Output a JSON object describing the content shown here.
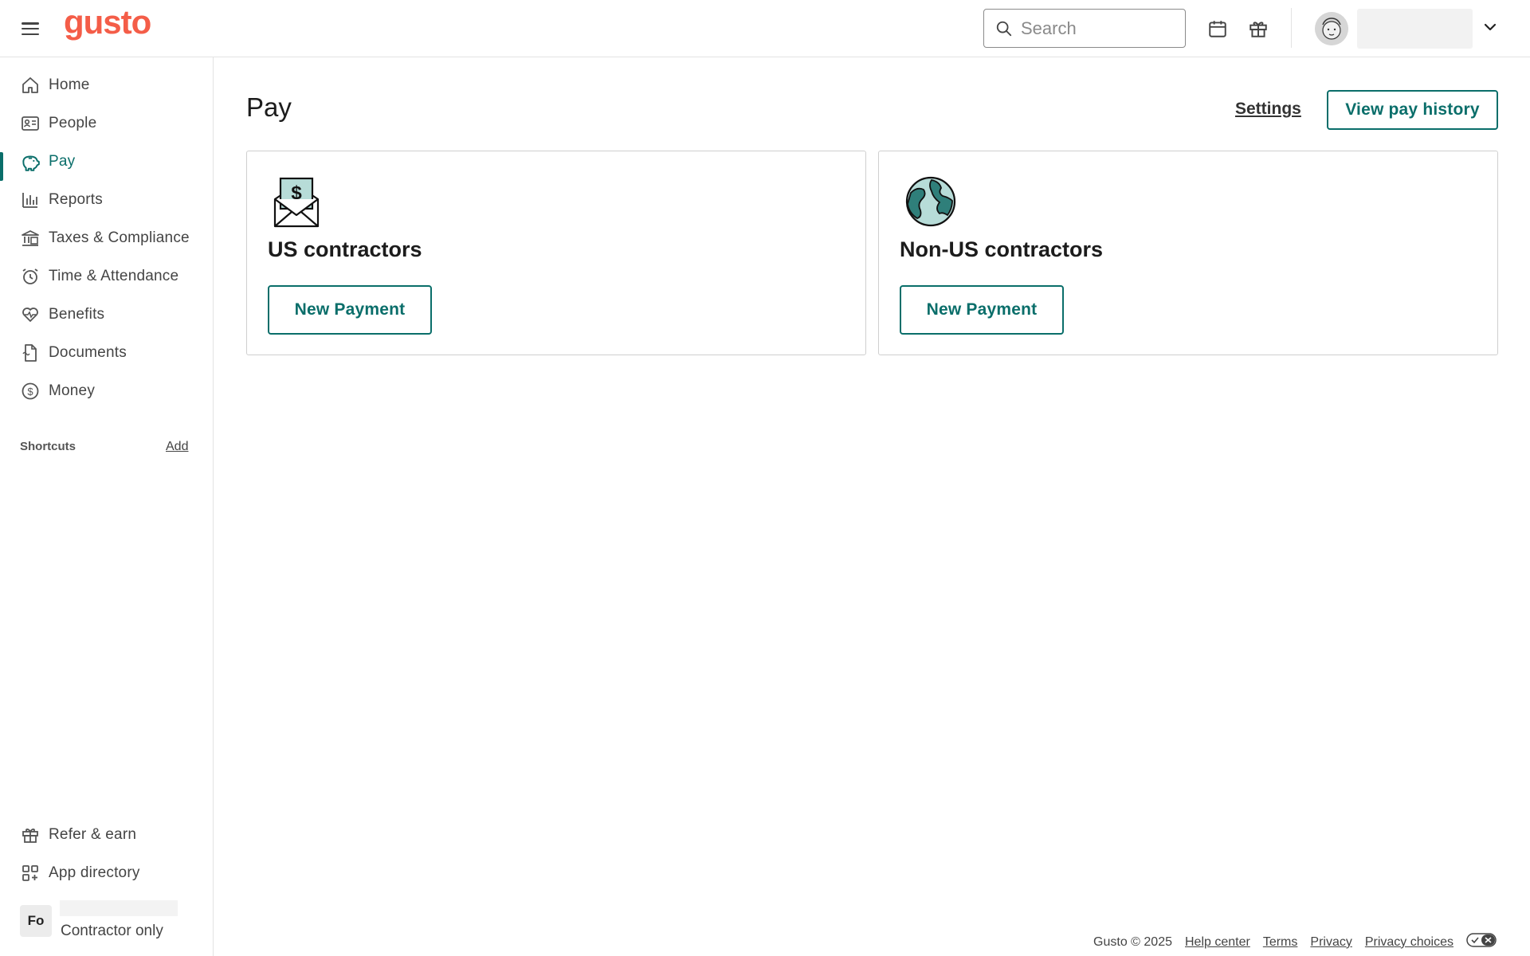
{
  "app": {
    "logo": "gusto"
  },
  "topbar": {
    "search_placeholder": "Search",
    "icons": [
      "calendar-icon",
      "gift-icon",
      "chevron-down-icon"
    ]
  },
  "sidebar": {
    "items": [
      {
        "label": "Home",
        "icon": "home-icon"
      },
      {
        "label": "People",
        "icon": "people-icon"
      },
      {
        "label": "Pay",
        "icon": "piggy-bank-icon",
        "active": true
      },
      {
        "label": "Reports",
        "icon": "bar-chart-icon"
      },
      {
        "label": "Taxes & Compliance",
        "icon": "bank-icon"
      },
      {
        "label": "Time & Attendance",
        "icon": "alarm-clock-icon"
      },
      {
        "label": "Benefits",
        "icon": "heart-pulse-icon"
      },
      {
        "label": "Documents",
        "icon": "document-icon"
      },
      {
        "label": "Money",
        "icon": "dollar-circle-icon"
      }
    ],
    "shortcuts_label": "Shortcuts",
    "shortcuts_add": "Add",
    "bottom_items": [
      {
        "label": "Refer & earn",
        "icon": "gift-icon"
      },
      {
        "label": "App directory",
        "icon": "apps-grid-icon"
      }
    ],
    "user": {
      "initials": "Fo",
      "role": "Contractor only"
    }
  },
  "main": {
    "title": "Pay",
    "settings_link": "Settings",
    "view_history_button": "View pay history",
    "cards": [
      {
        "title": "US contractors",
        "button": "New Payment",
        "icon": "envelope-dollar-icon"
      },
      {
        "title": "Non-US contractors",
        "button": "New Payment",
        "icon": "globe-icon"
      }
    ]
  },
  "footer": {
    "copyright": "Gusto © 2025",
    "links": [
      "Help center",
      "Terms",
      "Privacy",
      "Privacy choices"
    ]
  },
  "colors": {
    "brand": "#f45d48",
    "accent": "#0a6e6a",
    "teal_light": "#b7dcd8"
  }
}
